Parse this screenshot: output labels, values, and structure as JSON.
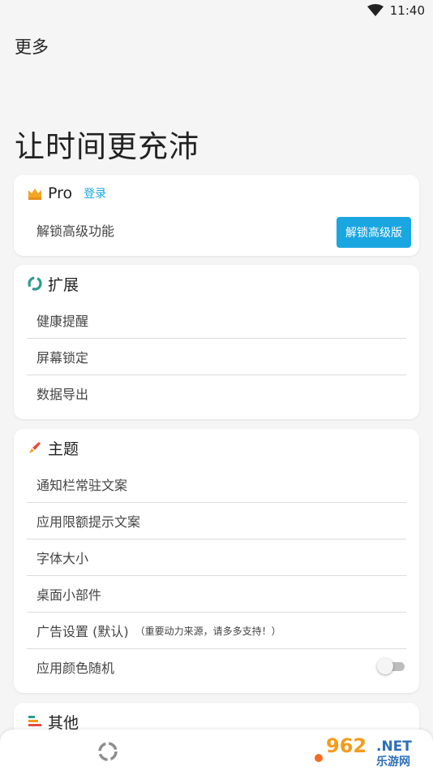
{
  "status_bar": {
    "time": "11:40",
    "wifi_icon": "wifi-icon"
  },
  "app_bar": {
    "title": "更多"
  },
  "headline": "让时间更充沛",
  "pro_card": {
    "title": "Pro",
    "login_label": "登录",
    "unlock_row_label": "解锁高级功能",
    "unlock_button_label": "解锁高级版",
    "icon": "crown-icon",
    "accent": "#1aa6e0"
  },
  "extend_card": {
    "title": "扩展",
    "icon": "ring-icon",
    "items": [
      "健康提醒",
      "屏幕锁定",
      "数据导出"
    ]
  },
  "theme_card": {
    "title": "主题",
    "icon": "brush-icon",
    "items": [
      "通知栏常驻文案",
      "应用限额提示文案",
      "字体大小",
      "桌面小部件",
      "广告设置 (默认)"
    ],
    "ad_note": "（重要动力来源，请多多支持！）",
    "random_color_label": "应用颜色随机",
    "random_color_enabled": false
  },
  "other_card": {
    "title": "其他",
    "icon": "list-icon"
  },
  "watermark": {
    "brand": "962",
    "suffix": ".NET",
    "subtitle": "乐游网"
  }
}
